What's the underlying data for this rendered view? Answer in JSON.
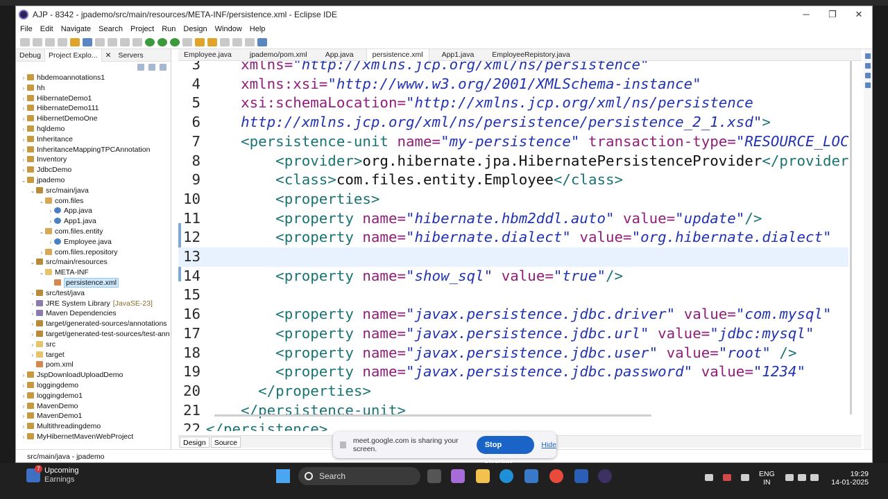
{
  "window": {
    "title": "AJP - 8342 - jpademo/src/main/resources/META-INF/persistence.xml - Eclipse IDE"
  },
  "menu": [
    "File",
    "Edit",
    "Navigate",
    "Search",
    "Project",
    "Run",
    "Design",
    "Window",
    "Help"
  ],
  "left_tabs": [
    "Debug",
    "Project Explo...",
    "Servers"
  ],
  "tree": [
    {
      "label": "hbdemoannotations1",
      "indent": 0,
      "arrow": "›",
      "icon": "proj"
    },
    {
      "label": "hh",
      "indent": 0,
      "arrow": "›",
      "icon": "proj"
    },
    {
      "label": "HibernateDemo1",
      "indent": 0,
      "arrow": "›",
      "icon": "proj"
    },
    {
      "label": "HibernateDemo111",
      "indent": 0,
      "arrow": "›",
      "icon": "proj"
    },
    {
      "label": "HibernetDemoOne",
      "indent": 0,
      "arrow": "›",
      "icon": "proj"
    },
    {
      "label": "hqldemo",
      "indent": 0,
      "arrow": "›",
      "icon": "proj"
    },
    {
      "label": "Inheritance",
      "indent": 0,
      "arrow": "›",
      "icon": "proj"
    },
    {
      "label": "InheritanceMappingTPCAnnotation",
      "indent": 0,
      "arrow": "›",
      "icon": "proj"
    },
    {
      "label": "Inventory",
      "indent": 0,
      "arrow": "›",
      "icon": "proj"
    },
    {
      "label": "JdbcDemo",
      "indent": 0,
      "arrow": "›",
      "icon": "proj"
    },
    {
      "label": "jpademo",
      "indent": 0,
      "arrow": "⌄",
      "icon": "proj"
    },
    {
      "label": "src/main/java",
      "indent": 1,
      "arrow": "⌄",
      "icon": "src"
    },
    {
      "label": "com.files",
      "indent": 2,
      "arrow": "⌄",
      "icon": "pkg"
    },
    {
      "label": "App.java",
      "indent": 3,
      "arrow": "›",
      "icon": "java"
    },
    {
      "label": "App1.java",
      "indent": 3,
      "arrow": "›",
      "icon": "java"
    },
    {
      "label": "com.files.entity",
      "indent": 2,
      "arrow": "⌄",
      "icon": "pkg"
    },
    {
      "label": "Employee.java",
      "indent": 3,
      "arrow": "›",
      "icon": "java"
    },
    {
      "label": "com.files.repository",
      "indent": 2,
      "arrow": "›",
      "icon": "pkg"
    },
    {
      "label": "src/main/resources",
      "indent": 1,
      "arrow": "⌄",
      "icon": "src"
    },
    {
      "label": "META-INF",
      "indent": 2,
      "arrow": "⌄",
      "icon": "fold"
    },
    {
      "label": "persistence.xml",
      "indent": 3,
      "arrow": "",
      "icon": "xml",
      "selected": true
    },
    {
      "label": "src/test/java",
      "indent": 1,
      "arrow": "›",
      "icon": "src"
    },
    {
      "label": "JRE System Library",
      "hint": "[JavaSE-23]",
      "indent": 1,
      "arrow": "›",
      "icon": "lib"
    },
    {
      "label": "Maven Dependencies",
      "indent": 1,
      "arrow": "›",
      "icon": "lib"
    },
    {
      "label": "target/generated-sources/annotations",
      "indent": 1,
      "arrow": "›",
      "icon": "src"
    },
    {
      "label": "target/generated-test-sources/test-anno",
      "indent": 1,
      "arrow": "›",
      "icon": "src"
    },
    {
      "label": "src",
      "indent": 1,
      "arrow": "›",
      "icon": "fold"
    },
    {
      "label": "target",
      "indent": 1,
      "arrow": "›",
      "icon": "fold"
    },
    {
      "label": "pom.xml",
      "indent": 1,
      "arrow": "",
      "icon": "xml"
    },
    {
      "label": "JspDownloadUploadDemo",
      "indent": 0,
      "arrow": "›",
      "icon": "proj"
    },
    {
      "label": "loggingdemo",
      "indent": 0,
      "arrow": "›",
      "icon": "proj"
    },
    {
      "label": "loggingdemo1",
      "indent": 0,
      "arrow": "›",
      "icon": "proj"
    },
    {
      "label": "MavenDemo",
      "indent": 0,
      "arrow": "›",
      "icon": "proj"
    },
    {
      "label": "MavenDemo1",
      "indent": 0,
      "arrow": "›",
      "icon": "proj"
    },
    {
      "label": "Multithreadingdemo",
      "indent": 0,
      "arrow": "›",
      "icon": "proj"
    },
    {
      "label": "MyHibernetMavenWebProject",
      "indent": 0,
      "arrow": "›",
      "icon": "proj"
    }
  ],
  "editor_tabs": [
    {
      "label": "Employee.java"
    },
    {
      "label": "jpademo/pom.xml"
    },
    {
      "label": "App.java"
    },
    {
      "label": "persistence.xml",
      "active": true
    },
    {
      "label": "App1.java"
    },
    {
      "label": "EmployeeRepistory.java"
    }
  ],
  "code_lines": [
    {
      "n": "3",
      "segs": [
        [
          "t",
          "    "
        ],
        [
          "at",
          "xmlns="
        ],
        [
          "val",
          "\"http://xmlns.jcp.org/xml/ns/persistence\""
        ]
      ]
    },
    {
      "n": "4",
      "segs": [
        [
          "t",
          "    "
        ],
        [
          "at",
          "xmlns:xsi="
        ],
        [
          "val",
          "\"http://www.w3.org/2001/XMLSchema-instance\""
        ]
      ]
    },
    {
      "n": "5",
      "segs": [
        [
          "t",
          "    "
        ],
        [
          "at",
          "xsi:schemaLocation="
        ],
        [
          "val",
          "\"http://xmlns.jcp.org/xml/ns/persistence"
        ]
      ]
    },
    {
      "n": "6",
      "segs": [
        [
          "t",
          "    "
        ],
        [
          "val",
          "http://xmlns.jcp.org/xml/ns/persistence/persistence_2_1.xsd\""
        ],
        [
          "tag",
          ">"
        ]
      ]
    },
    {
      "n": "7",
      "segs": [
        [
          "t",
          "    "
        ],
        [
          "tag",
          "<persistence-unit "
        ],
        [
          "at",
          "name="
        ],
        [
          "val",
          "\"my-persistence\""
        ],
        [
          "t",
          " "
        ],
        [
          "at",
          "transaction-type="
        ],
        [
          "val",
          "\"RESOURCE_LOCAL\""
        ]
      ]
    },
    {
      "n": "8",
      "segs": [
        [
          "t",
          "        "
        ],
        [
          "tag",
          "<provider>"
        ],
        [
          "t",
          "org.hibernate.jpa.HibernatePersistenceProvider"
        ],
        [
          "tag",
          "</provider>"
        ]
      ]
    },
    {
      "n": "9",
      "segs": [
        [
          "t",
          "        "
        ],
        [
          "tag",
          "<class>"
        ],
        [
          "t",
          "com.files.entity.Employee"
        ],
        [
          "tag",
          "</class>"
        ]
      ]
    },
    {
      "n": "10",
      "segs": [
        [
          "t",
          "        "
        ],
        [
          "tag",
          "<properties>"
        ]
      ]
    },
    {
      "n": "11",
      "segs": [
        [
          "t",
          "        "
        ],
        [
          "tag",
          "<property "
        ],
        [
          "at",
          "name="
        ],
        [
          "val",
          "\"hibernate.hbm2ddl.auto\""
        ],
        [
          "t",
          " "
        ],
        [
          "at",
          "value="
        ],
        [
          "val",
          "\"update\""
        ],
        [
          "tag",
          "/>"
        ]
      ]
    },
    {
      "n": "12",
      "segs": [
        [
          "t",
          "        "
        ],
        [
          "tag",
          "<property "
        ],
        [
          "at",
          "name="
        ],
        [
          "val",
          "\"hibernate.dialect\""
        ],
        [
          "t",
          " "
        ],
        [
          "at",
          "value="
        ],
        [
          "val",
          "\"org.hibernate.dialect\""
        ]
      ]
    },
    {
      "n": "13",
      "segs": []
    },
    {
      "n": "14",
      "segs": [
        [
          "t",
          "        "
        ],
        [
          "tag",
          "<property "
        ],
        [
          "at",
          "name="
        ],
        [
          "val",
          "\"show_sql\""
        ],
        [
          "t",
          " "
        ],
        [
          "at",
          "value="
        ],
        [
          "val",
          "\"true\""
        ],
        [
          "tag",
          "/>"
        ]
      ]
    },
    {
      "n": "15",
      "segs": []
    },
    {
      "n": "16",
      "segs": [
        [
          "t",
          "        "
        ],
        [
          "tag",
          "<property "
        ],
        [
          "at",
          "name="
        ],
        [
          "val",
          "\"javax.persistence.jdbc.driver\""
        ],
        [
          "t",
          " "
        ],
        [
          "at",
          "value="
        ],
        [
          "val",
          "\"com.mysql\""
        ]
      ]
    },
    {
      "n": "17",
      "segs": [
        [
          "t",
          "        "
        ],
        [
          "tag",
          "<property "
        ],
        [
          "at",
          "name="
        ],
        [
          "val",
          "\"javax.persistence.jdbc.url\""
        ],
        [
          "t",
          " "
        ],
        [
          "at",
          "value="
        ],
        [
          "val",
          "\"jdbc:mysql\""
        ]
      ]
    },
    {
      "n": "18",
      "segs": [
        [
          "t",
          "        "
        ],
        [
          "tag",
          "<property "
        ],
        [
          "at",
          "name="
        ],
        [
          "val",
          "\"javax.persistence.jdbc.user\""
        ],
        [
          "t",
          " "
        ],
        [
          "at",
          "value="
        ],
        [
          "val",
          "\"root\""
        ],
        [
          "t",
          " "
        ],
        [
          "tag",
          "/>"
        ]
      ]
    },
    {
      "n": "19",
      "segs": [
        [
          "t",
          "        "
        ],
        [
          "tag",
          "<property "
        ],
        [
          "at",
          "name="
        ],
        [
          "val",
          "\"javax.persistence.jdbc.password\""
        ],
        [
          "t",
          " "
        ],
        [
          "at",
          "value="
        ],
        [
          "val",
          "\"1234\""
        ]
      ]
    },
    {
      "n": "20",
      "segs": [
        [
          "t",
          "      "
        ],
        [
          "tag",
          "</properties>"
        ]
      ]
    },
    {
      "n": "21",
      "segs": [
        [
          "t",
          "    "
        ],
        [
          "tag",
          "</persistence-unit>"
        ]
      ]
    },
    {
      "n": "22",
      "segs": [
        [
          "tag",
          "</persistence>"
        ]
      ]
    }
  ],
  "editor_bottom_tabs": [
    "Design",
    "Source"
  ],
  "status": {
    "path": "src/main/java - jpademo"
  },
  "meet": {
    "message": "meet.google.com is sharing your screen.",
    "stop": "Stop sharing",
    "hide": "Hide"
  },
  "taskbar": {
    "weather_title": "Upcoming",
    "weather_sub": "Earnings",
    "badge": "7",
    "search": "Search",
    "lang1": "ENG",
    "lang2": "IN",
    "time": "19:29",
    "date": "14-01-2025"
  },
  "colors": {
    "accent": "#1a64c8",
    "tag": "#1a7373",
    "attr": "#8f1f7a",
    "value": "#2233b0"
  }
}
